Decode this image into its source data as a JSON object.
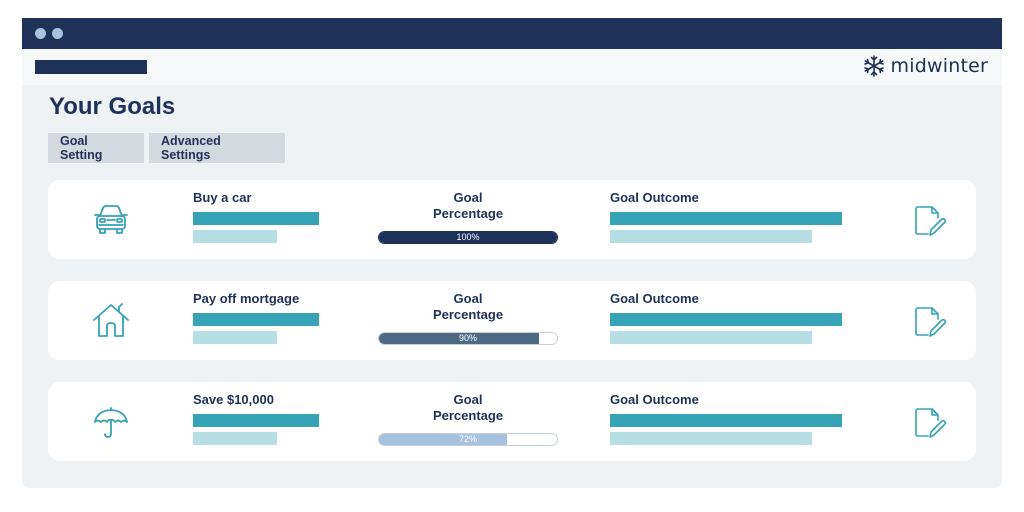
{
  "window": {
    "title_dots": [
      "dot-1",
      "dot-2"
    ]
  },
  "header": {
    "brand": "midwinter",
    "brand_icon": "snowflake-icon"
  },
  "page": {
    "title": "Your Goals",
    "tabs": [
      {
        "label": "Goal Setting"
      },
      {
        "label": "Advanced Settings"
      }
    ]
  },
  "goals": [
    {
      "name": "Buy a car",
      "icon": "car-icon",
      "percentage_label": "Goal Percentage",
      "percentage": 100,
      "percentage_text": "100%",
      "fill_color": "#1e3158",
      "outcome_label": "Goal Outcome",
      "edit_icon": "edit-document-icon"
    },
    {
      "name": "Pay off mortgage",
      "icon": "house-icon",
      "percentage_label": "Goal Percentage",
      "percentage": 90,
      "percentage_text": "90%",
      "fill_color": "#4e6a82",
      "outcome_label": "Goal Outcome",
      "edit_icon": "edit-document-icon"
    },
    {
      "name": "Save $10,000",
      "icon": "umbrella-icon",
      "percentage_label": "Goal Percentage",
      "percentage": 72,
      "percentage_text": "72%",
      "fill_color": "#a7c2dd",
      "outcome_label": "Goal Outcome",
      "edit_icon": "edit-document-icon"
    }
  ],
  "colors": {
    "navy": "#1e3158",
    "teal": "#36a3b6",
    "teal_light": "#b5dfe5",
    "background": "#eff2f5"
  }
}
